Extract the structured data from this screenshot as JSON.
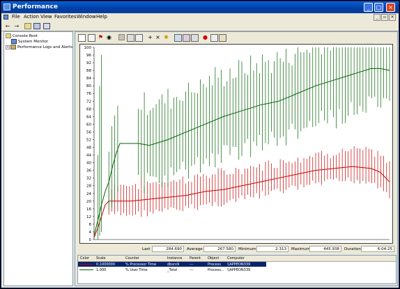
{
  "window": {
    "title": "Performance"
  },
  "menu": [
    "File",
    "Action",
    "View",
    "Favorites",
    "Window",
    "Help"
  ],
  "tree": {
    "root": "Console Root",
    "children": [
      "System Monitor",
      "Performance Logs and Alerts"
    ]
  },
  "stats": {
    "last_label": "Last",
    "last_value": "284.690",
    "average_label": "Average",
    "average_value": "267.580",
    "minimum_label": "Minimum",
    "minimum_value": "2.313",
    "maximum_label": "Maximum",
    "maximum_value": "445.938",
    "duration_label": "Duration",
    "duration_value": "6:04:25"
  },
  "legend": {
    "headers": [
      "Color",
      "Scale",
      "Counter",
      "Instance",
      "Parent",
      "Object",
      "Computer"
    ],
    "rows": [
      {
        "scale": "0.1000000",
        "counter": "% Processor Time",
        "instance": "dbsrv9",
        "parent": "---",
        "object": "Process",
        "computer": "\\\\APPEON339",
        "color": "#c00000",
        "selected": true
      },
      {
        "scale": "1.000",
        "counter": "% User Time",
        "instance": "_Total",
        "parent": "---",
        "object": "Process...",
        "computer": "\\\\APPEON339",
        "color": "#006000",
        "selected": false
      }
    ]
  },
  "colors": {
    "red_series": "#c00000",
    "green_series": "#006000"
  },
  "chart_data": {
    "type": "line",
    "ylim": [
      0,
      100
    ],
    "yticks": [
      0,
      4,
      8,
      12,
      16,
      20,
      24,
      28,
      32,
      36,
      40,
      44,
      48,
      52,
      56,
      60,
      64,
      68,
      72,
      76,
      80,
      84,
      88,
      92,
      96,
      100
    ],
    "grid": false,
    "series": [
      {
        "name": "% Processor Time",
        "color": "#c00000",
        "avg": [
          [
            0,
            1
          ],
          [
            2,
            6
          ],
          [
            4,
            12
          ],
          [
            6,
            18
          ],
          [
            8,
            20
          ],
          [
            10,
            20
          ],
          [
            20,
            20
          ],
          [
            30,
            21
          ],
          [
            40,
            22
          ],
          [
            50,
            23
          ],
          [
            60,
            25
          ],
          [
            70,
            26
          ],
          [
            80,
            28
          ],
          [
            90,
            30
          ],
          [
            100,
            32
          ],
          [
            110,
            34
          ],
          [
            120,
            36
          ],
          [
            130,
            37
          ],
          [
            140,
            38
          ],
          [
            150,
            37
          ],
          [
            155,
            35
          ],
          [
            160,
            30
          ]
        ]
      },
      {
        "name": "% User Time",
        "color": "#006000",
        "avg": [
          [
            0,
            2
          ],
          [
            2,
            10
          ],
          [
            4,
            18
          ],
          [
            6,
            25
          ],
          [
            8,
            30
          ],
          [
            10,
            38
          ],
          [
            12,
            45
          ],
          [
            14,
            50
          ],
          [
            24,
            50
          ],
          [
            30,
            49
          ],
          [
            40,
            52
          ],
          [
            50,
            56
          ],
          [
            60,
            60
          ],
          [
            70,
            64
          ],
          [
            80,
            67
          ],
          [
            90,
            70
          ],
          [
            100,
            72
          ],
          [
            110,
            76
          ],
          [
            120,
            80
          ],
          [
            130,
            83
          ],
          [
            140,
            86
          ],
          [
            150,
            89
          ],
          [
            155,
            89
          ],
          [
            160,
            88
          ]
        ]
      }
    ]
  }
}
